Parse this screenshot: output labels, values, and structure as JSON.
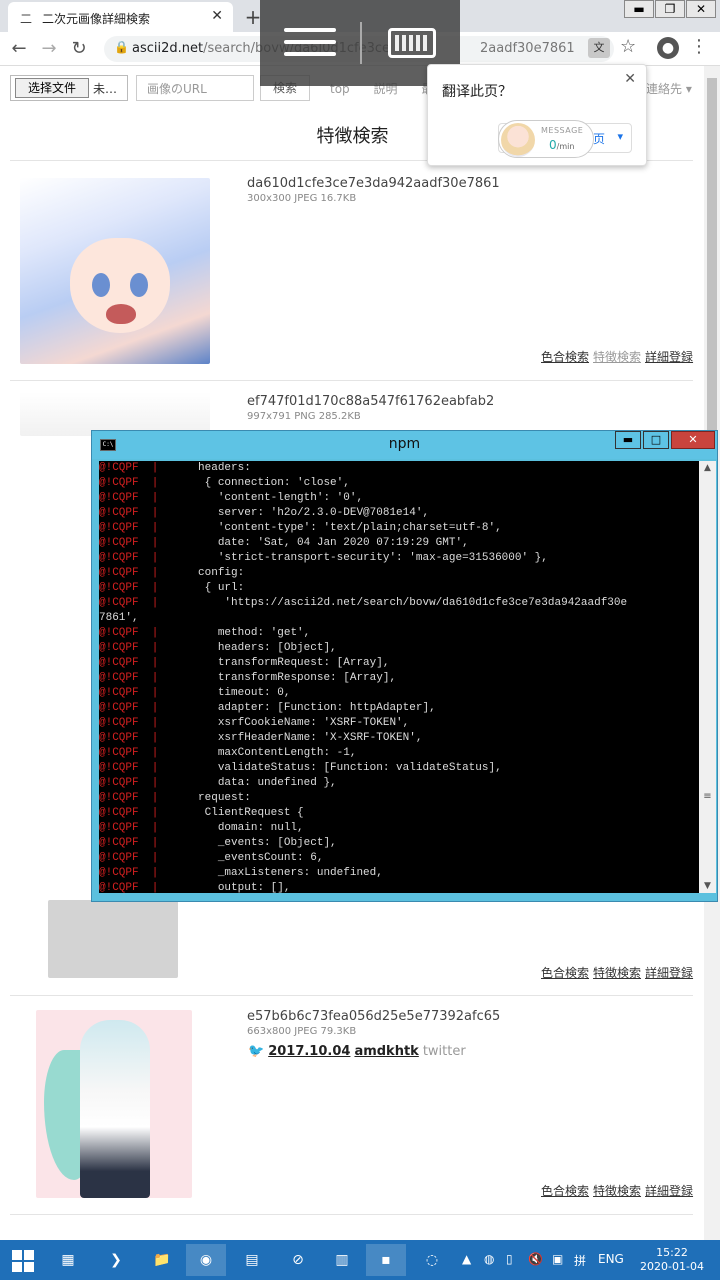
{
  "browser": {
    "tab_favicon": "二",
    "tab_title": "二次元画像詳細検索",
    "tab_close": "✕",
    "new_tab": "+",
    "url_host": "ascii2d.net",
    "url_path": "/search/bovw/da6l0d1cfe3ce",
    "url_tail": "2aadf30e7861",
    "translate_icon": "文",
    "star": "☆",
    "menu": "⋮",
    "window_min": "▬",
    "window_max": "❐",
    "window_close": "✕"
  },
  "search_form": {
    "file_button": "选择文件",
    "file_name": "未…",
    "url_placeholder": "画像のURL",
    "search_button": "検索",
    "nav": [
      "top",
      "説明",
      "最近"
    ],
    "nav_right": "連絡先 ▾"
  },
  "page": {
    "heading": "特徴検索"
  },
  "results": [
    {
      "hash": "da610d1cfe3ce7e3da942aadf30e7861",
      "meta": "300x300 JPEG 16.7KB",
      "actions": [
        "色合検索",
        "特徴検索",
        "詳細登録"
      ]
    },
    {
      "hash": "ef747f01d170c88a547f61762eabfab2",
      "meta": "997x791 PNG 285.2KB"
    },
    {
      "actions": [
        "色合検索",
        "特徴検索",
        "詳細登録"
      ]
    },
    {
      "hash": "e57b6b6c73fea056d25e5e77392afc65",
      "meta": "663x800 JPEG 79.3KB",
      "twitter_date": "2017.10.04",
      "twitter_user": "amdkhtk",
      "twitter_site": "twitter",
      "actions": [
        "色合検索",
        "特徴検索",
        "詳細登録"
      ]
    }
  ],
  "translate_popup": {
    "question": "翻译此页？",
    "close": "✕",
    "option": "页",
    "caret": "▾"
  },
  "message_widget": {
    "label": "MESSAGE",
    "rate_value": "0",
    "rate_unit": "/min"
  },
  "console": {
    "title": "npm",
    "icon": "C:\\",
    "btn_min": "▬",
    "btn_max": "□",
    "btn_close": "✕",
    "scroll_up": "▲",
    "scroll_down": "▼",
    "scroll_grip": "≡",
    "prefix": "@!CQPF  |",
    "lines": [
      "      headers:",
      "       { connection: 'close',",
      "         'content-length': '0',",
      "         server: 'h2o/2.3.0-DEV@7081e14',",
      "         'content-type': 'text/plain;charset=utf-8',",
      "         date: 'Sat, 04 Jan 2020 07:19:29 GMT',",
      "         'strict-transport-security': 'max-age=31536000' },",
      "      config:",
      "       { url:",
      "          'https://ascii2d.net/search/bovw/da610d1cfe3ce7e3da942aadf30e",
      "7861',",
      "         method: 'get',",
      "         headers: [Object],",
      "         transformRequest: [Array],",
      "         transformResponse: [Array],",
      "         timeout: 0,",
      "         adapter: [Function: httpAdapter],",
      "         xsrfCookieName: 'XSRF-TOKEN',",
      "         xsrfHeaderName: 'X-XSRF-TOKEN',",
      "         maxContentLength: -1,",
      "         validateStatus: [Function: validateStatus],",
      "         data: undefined },",
      "      request:",
      "       ClientRequest {",
      "         domain: null,",
      "         _events: [Object],",
      "         _eventsCount: 6,",
      "         _maxListeners: undefined,",
      "         output: [],"
    ]
  },
  "taskbar": {
    "language": "ENG",
    "time": "15:22",
    "date": "2020-01-04"
  }
}
